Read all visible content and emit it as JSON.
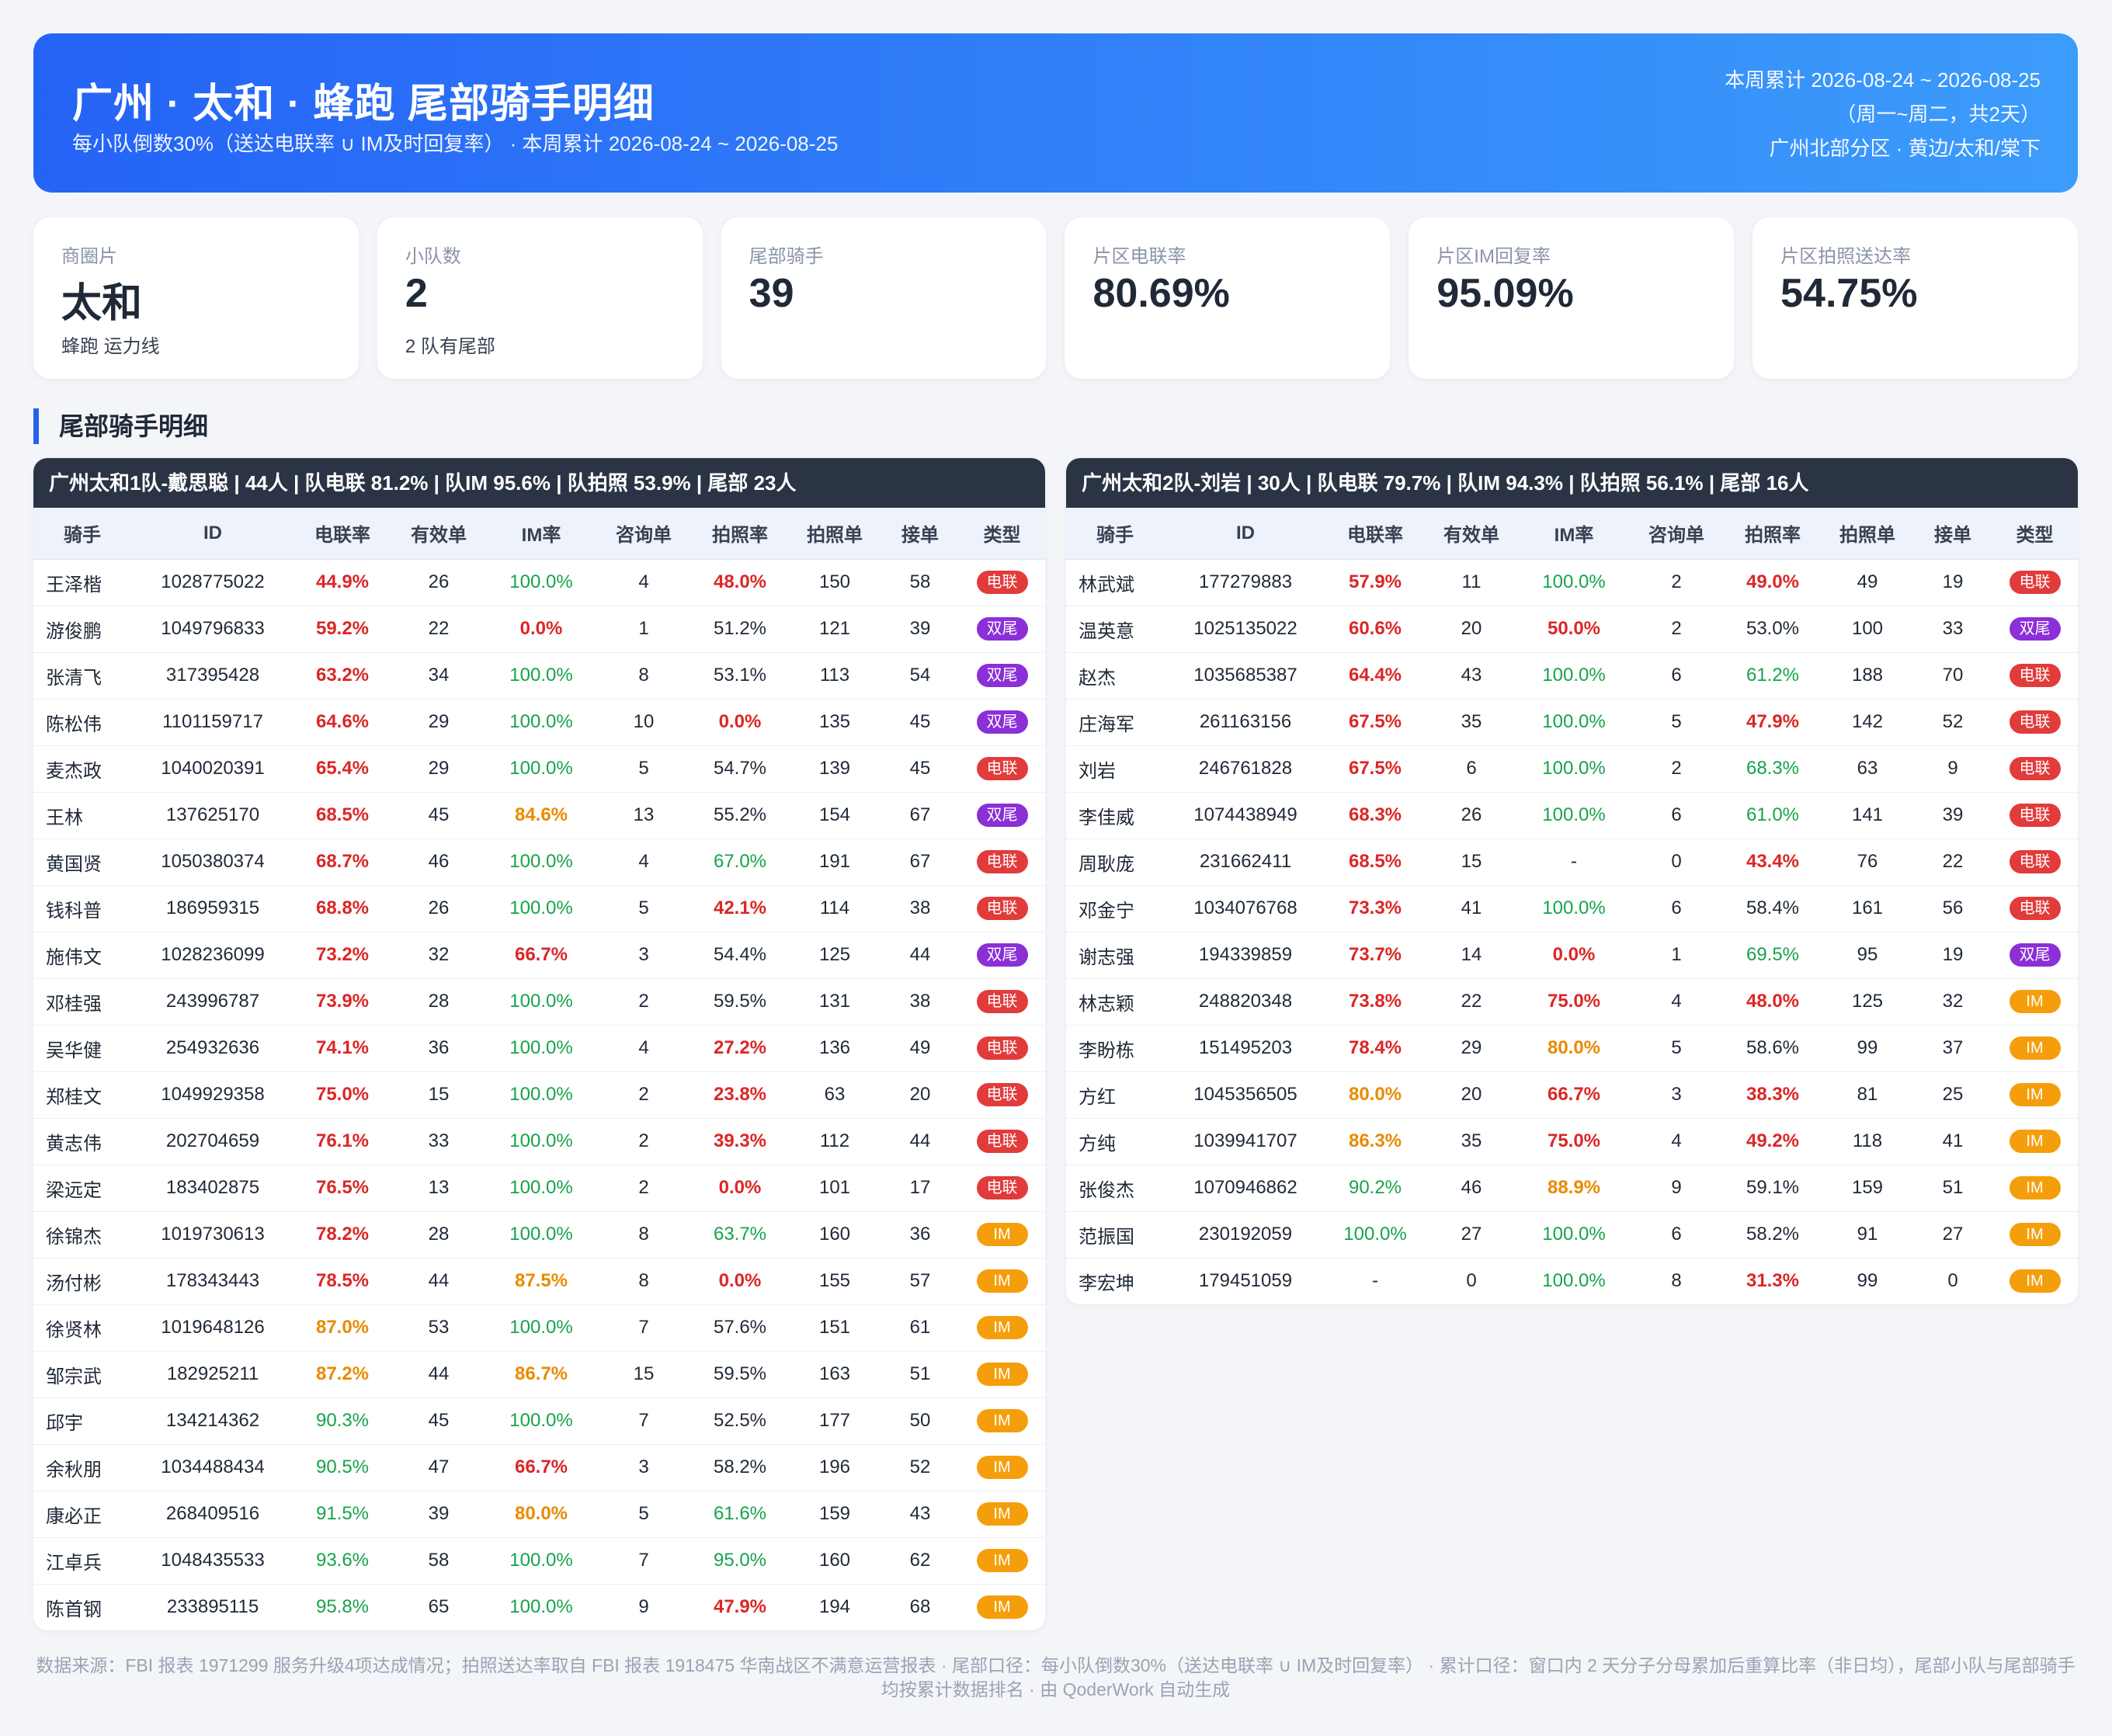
{
  "header": {
    "title": "广州 · 太和 · 蜂跑 尾部骑手明细",
    "subtitle": "每小队倒数30%（送达电联率 ∪ IM及时回复率）    ·   本周累计 2026-08-24 ~ 2026-08-25",
    "right_line1": "本周累计 2026-08-24 ~ 2026-08-25",
    "right_line2": "（周一~周二，共2天）",
    "right_line3": "广州北部分区 · 黄边/太和/棠下"
  },
  "cards": [
    {
      "label": "商圈片",
      "value": "太和",
      "note": "蜂跑 运力线"
    },
    {
      "label": "小队数",
      "value": "2",
      "note": "2 队有尾部"
    },
    {
      "label": "尾部骑手",
      "value": "39",
      "note": ""
    },
    {
      "label": "片区电联率",
      "value": "80.69%",
      "note": ""
    },
    {
      "label": "片区IM回复率",
      "value": "95.09%",
      "note": ""
    },
    {
      "label": "片区拍照送达率",
      "value": "54.75%",
      "note": ""
    }
  ],
  "section_title": "尾部骑手明细",
  "columns": [
    "骑手",
    "ID",
    "电联率",
    "有效单",
    "IM率",
    "咨询单",
    "拍照率",
    "拍照单",
    "接单",
    "类型"
  ],
  "badge_colors": {
    "电联": "#e23b3b",
    "双尾": "#8b2fd6",
    "IM": "#f59e0b"
  },
  "teams": [
    {
      "header": "广州太和1队-戴思聪  |  44人  |  队电联 81.2%  |  队IM 95.6%    |  队拍照 53.9%  |  尾部 23人",
      "rows": [
        [
          "王泽楷",
          "1028775022",
          "44.9%",
          "26",
          "100.0%",
          "4",
          "48.0%",
          "150",
          "58",
          "电联"
        ],
        [
          "游俊鹏",
          "1049796833",
          "59.2%",
          "22",
          "0.0%",
          "1",
          "51.2%",
          "121",
          "39",
          "双尾"
        ],
        [
          "张清飞",
          "317395428",
          "63.2%",
          "34",
          "100.0%",
          "8",
          "53.1%",
          "113",
          "54",
          "双尾"
        ],
        [
          "陈松伟",
          "1101159717",
          "64.6%",
          "29",
          "100.0%",
          "10",
          "0.0%",
          "135",
          "45",
          "双尾"
        ],
        [
          "麦杰政",
          "1040020391",
          "65.4%",
          "29",
          "100.0%",
          "5",
          "54.7%",
          "139",
          "45",
          "电联"
        ],
        [
          "王林",
          "137625170",
          "68.5%",
          "45",
          "84.6%",
          "13",
          "55.2%",
          "154",
          "67",
          "双尾"
        ],
        [
          "黄国贤",
          "1050380374",
          "68.7%",
          "46",
          "100.0%",
          "4",
          "67.0%",
          "191",
          "67",
          "电联"
        ],
        [
          "钱科普",
          "186959315",
          "68.8%",
          "26",
          "100.0%",
          "5",
          "42.1%",
          "114",
          "38",
          "电联"
        ],
        [
          "施伟文",
          "1028236099",
          "73.2%",
          "32",
          "66.7%",
          "3",
          "54.4%",
          "125",
          "44",
          "双尾"
        ],
        [
          "邓桂强",
          "243996787",
          "73.9%",
          "28",
          "100.0%",
          "2",
          "59.5%",
          "131",
          "38",
          "电联"
        ],
        [
          "吴华健",
          "254932636",
          "74.1%",
          "36",
          "100.0%",
          "4",
          "27.2%",
          "136",
          "49",
          "电联"
        ],
        [
          "郑桂文",
          "1049929358",
          "75.0%",
          "15",
          "100.0%",
          "2",
          "23.8%",
          "63",
          "20",
          "电联"
        ],
        [
          "黄志伟",
          "202704659",
          "76.1%",
          "33",
          "100.0%",
          "2",
          "39.3%",
          "112",
          "44",
          "电联"
        ],
        [
          "梁远定",
          "183402875",
          "76.5%",
          "13",
          "100.0%",
          "2",
          "0.0%",
          "101",
          "17",
          "电联"
        ],
        [
          "徐锦杰",
          "1019730613",
          "78.2%",
          "28",
          "100.0%",
          "8",
          "63.7%",
          "160",
          "36",
          "IM"
        ],
        [
          "汤付彬",
          "178343443",
          "78.5%",
          "44",
          "87.5%",
          "8",
          "0.0%",
          "155",
          "57",
          "IM"
        ],
        [
          "徐贤林",
          "1019648126",
          "87.0%",
          "53",
          "100.0%",
          "7",
          "57.6%",
          "151",
          "61",
          "IM"
        ],
        [
          "邹宗武",
          "182925211",
          "87.2%",
          "44",
          "86.7%",
          "15",
          "59.5%",
          "163",
          "51",
          "IM"
        ],
        [
          "邱宇",
          "134214362",
          "90.3%",
          "45",
          "100.0%",
          "7",
          "52.5%",
          "177",
          "50",
          "IM"
        ],
        [
          "余秋朋",
          "1034488434",
          "90.5%",
          "47",
          "66.7%",
          "3",
          "58.2%",
          "196",
          "52",
          "IM"
        ],
        [
          "康必正",
          "268409516",
          "91.5%",
          "39",
          "80.0%",
          "5",
          "61.6%",
          "159",
          "43",
          "IM"
        ],
        [
          "江卓兵",
          "1048435533",
          "93.6%",
          "58",
          "100.0%",
          "7",
          "95.0%",
          "160",
          "62",
          "IM"
        ],
        [
          "陈首钢",
          "233895115",
          "95.8%",
          "65",
          "100.0%",
          "9",
          "47.9%",
          "194",
          "68",
          "IM"
        ]
      ]
    },
    {
      "header": "广州太和2队-刘岩  |  30人  |  队电联 79.7%  |  队IM 94.3%    |  队拍照 56.1%  |  尾部 16人",
      "rows": [
        [
          "林武斌",
          "177279883",
          "57.9%",
          "11",
          "100.0%",
          "2",
          "49.0%",
          "49",
          "19",
          "电联"
        ],
        [
          "温英意",
          "1025135022",
          "60.6%",
          "20",
          "50.0%",
          "2",
          "53.0%",
          "100",
          "33",
          "双尾"
        ],
        [
          "赵杰",
          "1035685387",
          "64.4%",
          "43",
          "100.0%",
          "6",
          "61.2%",
          "188",
          "70",
          "电联"
        ],
        [
          "庄海军",
          "261163156",
          "67.5%",
          "35",
          "100.0%",
          "5",
          "47.9%",
          "142",
          "52",
          "电联"
        ],
        [
          "刘岩",
          "246761828",
          "67.5%",
          "6",
          "100.0%",
          "2",
          "68.3%",
          "63",
          "9",
          "电联"
        ],
        [
          "李佳威",
          "1074438949",
          "68.3%",
          "26",
          "100.0%",
          "6",
          "61.0%",
          "141",
          "39",
          "电联"
        ],
        [
          "周耿庞",
          "231662411",
          "68.5%",
          "15",
          "-",
          "0",
          "43.4%",
          "76",
          "22",
          "电联"
        ],
        [
          "邓金宁",
          "1034076768",
          "73.3%",
          "41",
          "100.0%",
          "6",
          "58.4%",
          "161",
          "56",
          "电联"
        ],
        [
          "谢志强",
          "194339859",
          "73.7%",
          "14",
          "0.0%",
          "1",
          "69.5%",
          "95",
          "19",
          "双尾"
        ],
        [
          "林志颖",
          "248820348",
          "73.8%",
          "22",
          "75.0%",
          "4",
          "48.0%",
          "125",
          "32",
          "IM"
        ],
        [
          "李盼栋",
          "151495203",
          "78.4%",
          "29",
          "80.0%",
          "5",
          "58.6%",
          "99",
          "37",
          "IM"
        ],
        [
          "方红",
          "1045356505",
          "80.0%",
          "20",
          "66.7%",
          "3",
          "38.3%",
          "81",
          "25",
          "IM"
        ],
        [
          "方纯",
          "1039941707",
          "86.3%",
          "35",
          "75.0%",
          "4",
          "49.2%",
          "118",
          "41",
          "IM"
        ],
        [
          "张俊杰",
          "1070946862",
          "90.2%",
          "46",
          "88.9%",
          "9",
          "59.1%",
          "159",
          "51",
          "IM"
        ],
        [
          "范振国",
          "230192059",
          "100.0%",
          "27",
          "100.0%",
          "6",
          "58.2%",
          "91",
          "27",
          "IM"
        ],
        [
          "李宏坤",
          "179451059",
          "-",
          "0",
          "100.0%",
          "8",
          "31.3%",
          "99",
          "0",
          "IM"
        ]
      ]
    }
  ],
  "footer": "数据来源：FBI 报表 1971299 服务升级4项达成情况；拍照送达率取自 FBI 报表 1918475 华南战区不满意运营报表 · 尾部口径：每小队倒数30%（送达电联率 ∪ IM及时回复率）   ·   累计口径：窗口内 2 天分子分母累加后重算比率（非日均），尾部小队与尾部骑手均按累计数据排名 · 由 QoderWork 自动生成"
}
